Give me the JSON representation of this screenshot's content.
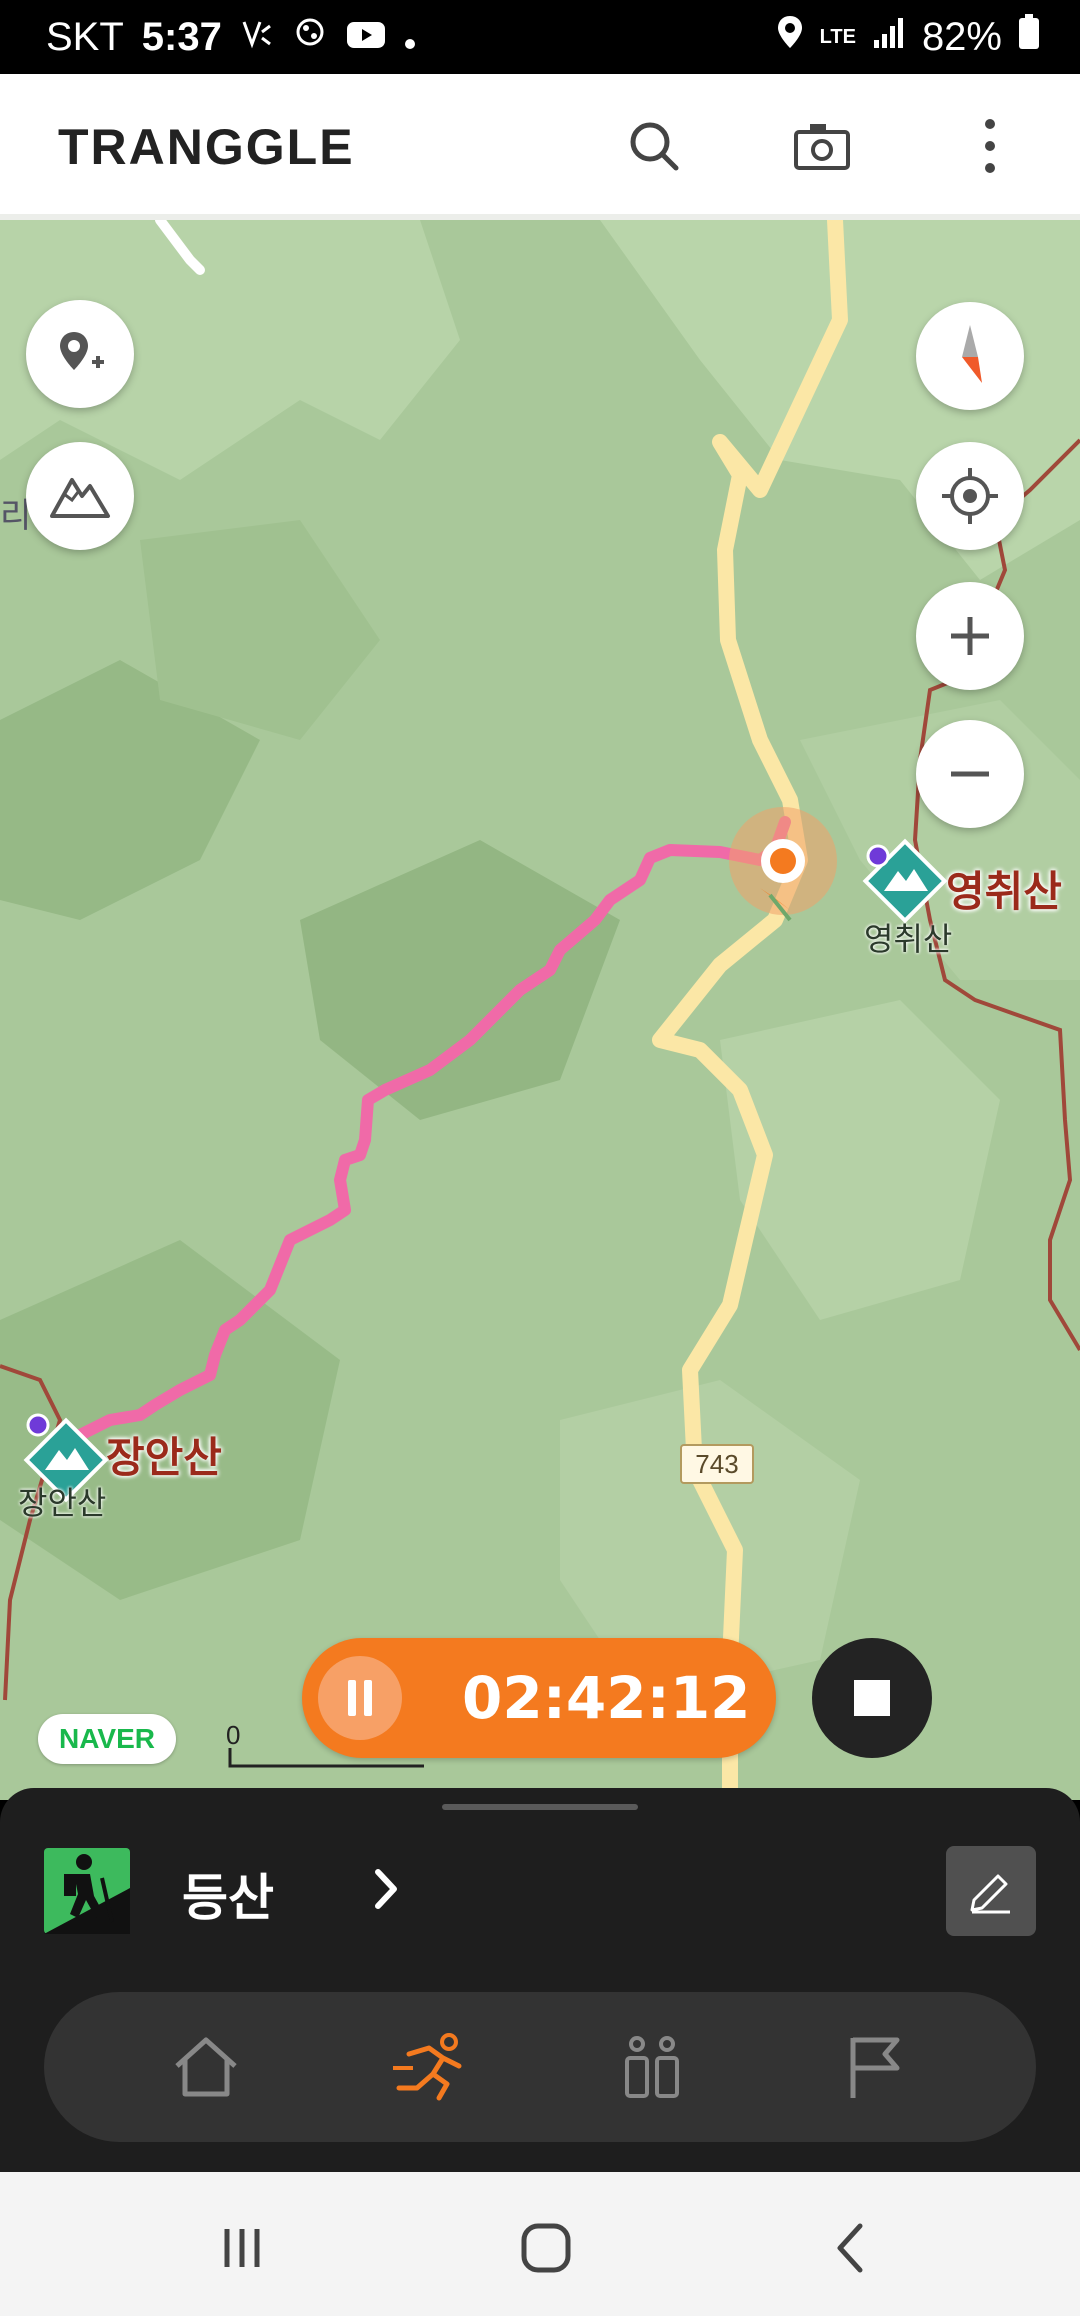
{
  "status_bar": {
    "carrier": "SKT",
    "time": "5:37",
    "network": "LTE",
    "battery": "82%"
  },
  "header": {
    "logo": "TRANGGLE",
    "icons": [
      "search-icon",
      "camera-icon",
      "more-vertical-icon"
    ]
  },
  "map": {
    "peaks": [
      {
        "name": "영취산",
        "sub": "영취산"
      },
      {
        "name": "장안산",
        "sub": "장안산"
      }
    ],
    "road_number": "743",
    "provider": "NAVER",
    "scale_label": "0",
    "edge_text": "리",
    "route_color": "#f06aa8",
    "road_color": "#fbe7a6",
    "trail_color": "#a0483a"
  },
  "recorder": {
    "elapsed": "02:42:12",
    "accent": "#f47a1f"
  },
  "activity": {
    "label": "등산"
  },
  "tabs": [
    {
      "name": "home",
      "active": false
    },
    {
      "name": "exercise",
      "active": true
    },
    {
      "name": "community",
      "active": false
    },
    {
      "name": "challenge",
      "active": false
    }
  ]
}
